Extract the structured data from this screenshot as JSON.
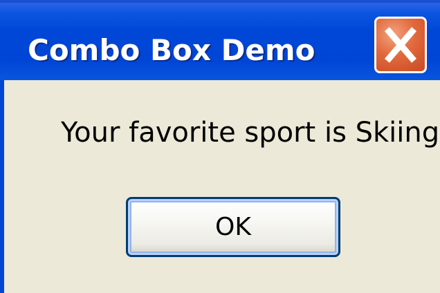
{
  "window": {
    "title": "Combo Box Demo",
    "close_icon": "close-icon"
  },
  "dialog": {
    "message": "Your favorite sport is Skiing",
    "ok_label": "OK"
  },
  "colors": {
    "titlebar": "#0046d6",
    "client_background": "#ece9d8",
    "close_button": "#e2693d",
    "button_border": "#003c74"
  }
}
